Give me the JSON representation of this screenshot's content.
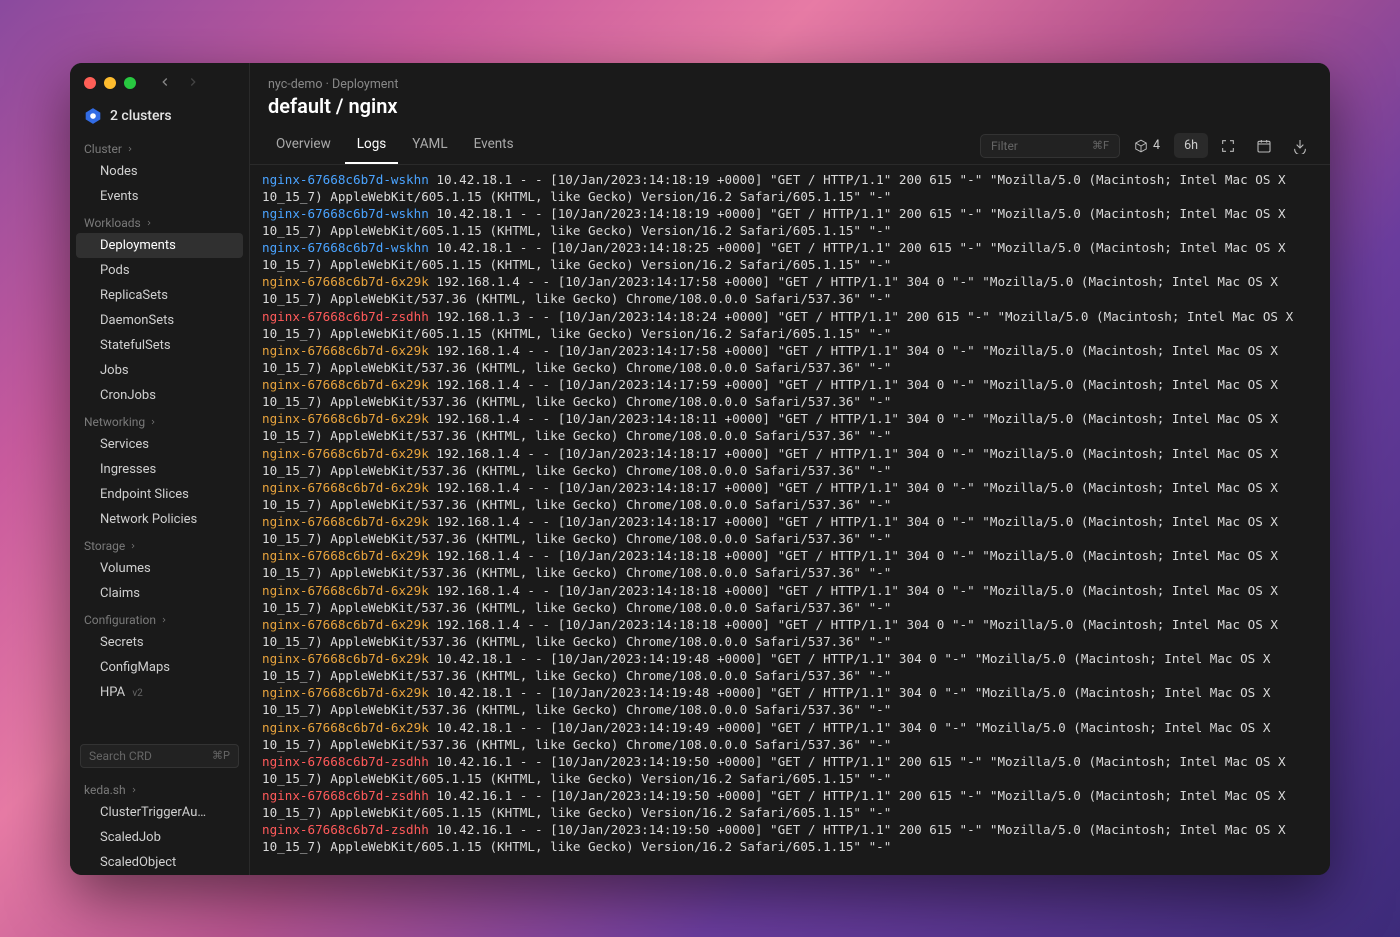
{
  "window": {
    "cluster_label": "2 clusters"
  },
  "sidebar": {
    "sections": [
      {
        "label": "Cluster",
        "items": [
          "Nodes",
          "Events"
        ]
      },
      {
        "label": "Workloads",
        "items": [
          "Deployments",
          "Pods",
          "ReplicaSets",
          "DaemonSets",
          "StatefulSets",
          "Jobs",
          "CronJobs"
        ],
        "active": "Deployments"
      },
      {
        "label": "Networking",
        "items": [
          "Services",
          "Ingresses",
          "Endpoint Slices",
          "Network Policies"
        ]
      },
      {
        "label": "Storage",
        "items": [
          "Volumes",
          "Claims"
        ]
      },
      {
        "label": "Configuration",
        "items": [
          "Secrets",
          "ConfigMaps"
        ]
      }
    ],
    "hpa_label": "HPA",
    "hpa_badge": "v2",
    "crd_search_placeholder": "Search CRD",
    "crd_search_kb": "⌘P",
    "keda_label": "keda.sh",
    "crd_items": [
      "ClusterTriggerAu…",
      "ScaledJob",
      "ScaledObject"
    ]
  },
  "header": {
    "breadcrumb_context": "nyc-demo",
    "breadcrumb_sep": " · ",
    "breadcrumb_kind": "Deployment",
    "title": "default / nginx",
    "tabs": [
      "Overview",
      "Logs",
      "YAML",
      "Events"
    ],
    "active_tab": "Logs",
    "filter_placeholder": "Filter",
    "filter_kb": "⌘F",
    "replica_count": "4",
    "time_range": "6h"
  },
  "log_palette": {
    "nginx-67668c6b7d-wskhn": "blue",
    "nginx-67668c6b7d-6x29k": "orange",
    "nginx-67668c6b7d-zsdhh": "red"
  },
  "log_lines": [
    {
      "pod": "nginx-67668c6b7d-wskhn",
      "rest": "10.42.18.1 - - [10/Jan/2023:14:18:19 +0000] \"GET / HTTP/1.1\" 200 615 \"-\" \"Mozilla/5.0 (Macintosh; Intel Mac OS X 10_15_7) AppleWebKit/605.1.15 (KHTML, like Gecko) Version/16.2 Safari/605.1.15\" \"-\""
    },
    {
      "pod": "nginx-67668c6b7d-wskhn",
      "rest": "10.42.18.1 - - [10/Jan/2023:14:18:19 +0000] \"GET / HTTP/1.1\" 200 615 \"-\" \"Mozilla/5.0 (Macintosh; Intel Mac OS X 10_15_7) AppleWebKit/605.1.15 (KHTML, like Gecko) Version/16.2 Safari/605.1.15\" \"-\""
    },
    {
      "pod": "nginx-67668c6b7d-wskhn",
      "rest": "10.42.18.1 - - [10/Jan/2023:14:18:25 +0000] \"GET / HTTP/1.1\" 200 615 \"-\" \"Mozilla/5.0 (Macintosh; Intel Mac OS X 10_15_7) AppleWebKit/605.1.15 (KHTML, like Gecko) Version/16.2 Safari/605.1.15\" \"-\""
    },
    {
      "pod": "nginx-67668c6b7d-6x29k",
      "rest": "192.168.1.4 - - [10/Jan/2023:14:17:58 +0000] \"GET / HTTP/1.1\" 304 0 \"-\" \"Mozilla/5.0 (Macintosh; Intel Mac OS X 10_15_7) AppleWebKit/537.36 (KHTML, like Gecko) Chrome/108.0.0.0 Safari/537.36\" \"-\""
    },
    {
      "pod": "nginx-67668c6b7d-zsdhh",
      "rest": "192.168.1.3 - - [10/Jan/2023:14:18:24 +0000] \"GET / HTTP/1.1\" 200 615 \"-\" \"Mozilla/5.0 (Macintosh; Intel Mac OS X 10_15_7) AppleWebKit/605.1.15 (KHTML, like Gecko) Version/16.2 Safari/605.1.15\" \"-\""
    },
    {
      "pod": "nginx-67668c6b7d-6x29k",
      "rest": "192.168.1.4 - - [10/Jan/2023:14:17:58 +0000] \"GET / HTTP/1.1\" 304 0 \"-\" \"Mozilla/5.0 (Macintosh; Intel Mac OS X 10_15_7) AppleWebKit/537.36 (KHTML, like Gecko) Chrome/108.0.0.0 Safari/537.36\" \"-\""
    },
    {
      "pod": "nginx-67668c6b7d-6x29k",
      "rest": "192.168.1.4 - - [10/Jan/2023:14:17:59 +0000] \"GET / HTTP/1.1\" 304 0 \"-\" \"Mozilla/5.0 (Macintosh; Intel Mac OS X 10_15_7) AppleWebKit/537.36 (KHTML, like Gecko) Chrome/108.0.0.0 Safari/537.36\" \"-\""
    },
    {
      "pod": "nginx-67668c6b7d-6x29k",
      "rest": "192.168.1.4 - - [10/Jan/2023:14:18:11 +0000] \"GET / HTTP/1.1\" 304 0 \"-\" \"Mozilla/5.0 (Macintosh; Intel Mac OS X 10_15_7) AppleWebKit/537.36 (KHTML, like Gecko) Chrome/108.0.0.0 Safari/537.36\" \"-\""
    },
    {
      "pod": "nginx-67668c6b7d-6x29k",
      "rest": "192.168.1.4 - - [10/Jan/2023:14:18:17 +0000] \"GET / HTTP/1.1\" 304 0 \"-\" \"Mozilla/5.0 (Macintosh; Intel Mac OS X 10_15_7) AppleWebKit/537.36 (KHTML, like Gecko) Chrome/108.0.0.0 Safari/537.36\" \"-\""
    },
    {
      "pod": "nginx-67668c6b7d-6x29k",
      "rest": "192.168.1.4 - - [10/Jan/2023:14:18:17 +0000] \"GET / HTTP/1.1\" 304 0 \"-\" \"Mozilla/5.0 (Macintosh; Intel Mac OS X 10_15_7) AppleWebKit/537.36 (KHTML, like Gecko) Chrome/108.0.0.0 Safari/537.36\" \"-\""
    },
    {
      "pod": "nginx-67668c6b7d-6x29k",
      "rest": "192.168.1.4 - - [10/Jan/2023:14:18:17 +0000] \"GET / HTTP/1.1\" 304 0 \"-\" \"Mozilla/5.0 (Macintosh; Intel Mac OS X 10_15_7) AppleWebKit/537.36 (KHTML, like Gecko) Chrome/108.0.0.0 Safari/537.36\" \"-\""
    },
    {
      "pod": "nginx-67668c6b7d-6x29k",
      "rest": "192.168.1.4 - - [10/Jan/2023:14:18:18 +0000] \"GET / HTTP/1.1\" 304 0 \"-\" \"Mozilla/5.0 (Macintosh; Intel Mac OS X 10_15_7) AppleWebKit/537.36 (KHTML, like Gecko) Chrome/108.0.0.0 Safari/537.36\" \"-\""
    },
    {
      "pod": "nginx-67668c6b7d-6x29k",
      "rest": "192.168.1.4 - - [10/Jan/2023:14:18:18 +0000] \"GET / HTTP/1.1\" 304 0 \"-\" \"Mozilla/5.0 (Macintosh; Intel Mac OS X 10_15_7) AppleWebKit/537.36 (KHTML, like Gecko) Chrome/108.0.0.0 Safari/537.36\" \"-\""
    },
    {
      "pod": "nginx-67668c6b7d-6x29k",
      "rest": "192.168.1.4 - - [10/Jan/2023:14:18:18 +0000] \"GET / HTTP/1.1\" 304 0 \"-\" \"Mozilla/5.0 (Macintosh; Intel Mac OS X 10_15_7) AppleWebKit/537.36 (KHTML, like Gecko) Chrome/108.0.0.0 Safari/537.36\" \"-\""
    },
    {
      "pod": "nginx-67668c6b7d-6x29k",
      "rest": "10.42.18.1 - - [10/Jan/2023:14:19:48 +0000] \"GET / HTTP/1.1\" 304 0 \"-\" \"Mozilla/5.0 (Macintosh; Intel Mac OS X 10_15_7) AppleWebKit/537.36 (KHTML, like Gecko) Chrome/108.0.0.0 Safari/537.36\" \"-\""
    },
    {
      "pod": "nginx-67668c6b7d-6x29k",
      "rest": "10.42.18.1 - - [10/Jan/2023:14:19:48 +0000] \"GET / HTTP/1.1\" 304 0 \"-\" \"Mozilla/5.0 (Macintosh; Intel Mac OS X 10_15_7) AppleWebKit/537.36 (KHTML, like Gecko) Chrome/108.0.0.0 Safari/537.36\" \"-\""
    },
    {
      "pod": "nginx-67668c6b7d-6x29k",
      "rest": "10.42.18.1 - - [10/Jan/2023:14:19:49 +0000] \"GET / HTTP/1.1\" 304 0 \"-\" \"Mozilla/5.0 (Macintosh; Intel Mac OS X 10_15_7) AppleWebKit/537.36 (KHTML, like Gecko) Chrome/108.0.0.0 Safari/537.36\" \"-\""
    },
    {
      "pod": "nginx-67668c6b7d-zsdhh",
      "rest": "10.42.16.1 - - [10/Jan/2023:14:19:50 +0000] \"GET / HTTP/1.1\" 200 615 \"-\" \"Mozilla/5.0 (Macintosh; Intel Mac OS X 10_15_7) AppleWebKit/605.1.15 (KHTML, like Gecko) Version/16.2 Safari/605.1.15\" \"-\""
    },
    {
      "pod": "nginx-67668c6b7d-zsdhh",
      "rest": "10.42.16.1 - - [10/Jan/2023:14:19:50 +0000] \"GET / HTTP/1.1\" 200 615 \"-\" \"Mozilla/5.0 (Macintosh; Intel Mac OS X 10_15_7) AppleWebKit/605.1.15 (KHTML, like Gecko) Version/16.2 Safari/605.1.15\" \"-\""
    },
    {
      "pod": "nginx-67668c6b7d-zsdhh",
      "rest": "10.42.16.1 - - [10/Jan/2023:14:19:50 +0000] \"GET / HTTP/1.1\" 200 615 \"-\" \"Mozilla/5.0 (Macintosh; Intel Mac OS X 10_15_7) AppleWebKit/605.1.15 (KHTML, like Gecko) Version/16.2 Safari/605.1.15\" \"-\""
    }
  ]
}
